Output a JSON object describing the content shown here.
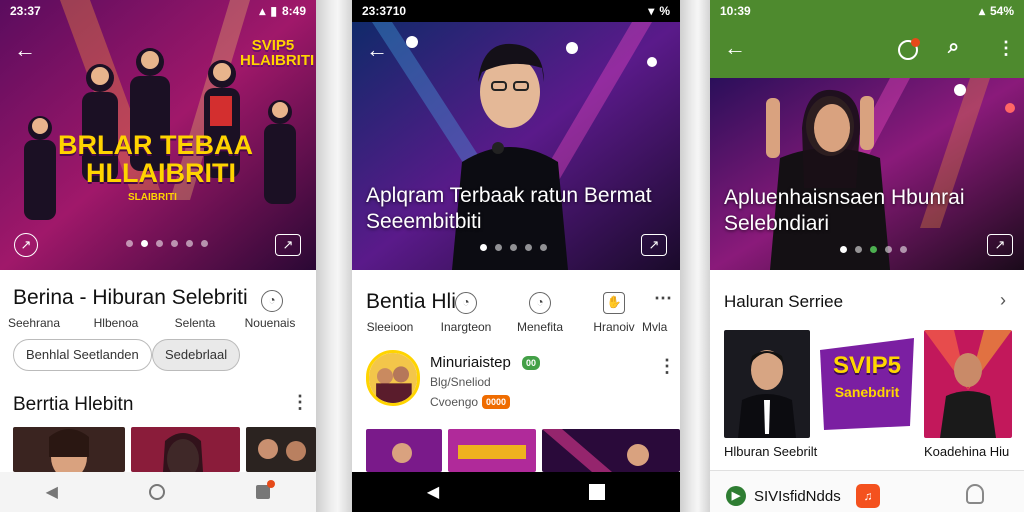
{
  "screen1": {
    "status": {
      "time": "23:37",
      "right": "8:49"
    },
    "hero": {
      "logo": "SVIP5 HLAIBRITI",
      "headline_1": "BRLAR TEBAA",
      "headline_2": "HLLAIBRITI",
      "tagline": "SLAIBRITI"
    },
    "title": "Berina - Hiburan Selebriti",
    "actions": [
      "Seehrana",
      "Hlbenoa",
      "Selenta",
      "Nouenais"
    ],
    "chips": [
      "Benhlal Seetlanden",
      "Sedebrlaal"
    ],
    "section_title": "Berrtia Hlebitn",
    "colors": {
      "accent": "#c2185b",
      "nav_bg": "#f4f4f4"
    }
  },
  "screen2": {
    "status": {
      "time": "23:3710",
      "right": "%"
    },
    "hero": {
      "title": "Aplqram Terbaak ratun Bermat Seeembitbiti"
    },
    "title": "Bentia Hli",
    "actions": [
      "Sleeioon",
      "Inargteon",
      "Menefita",
      "Hranoiv",
      "Mvla"
    ],
    "card": {
      "name": "Minuriaistep",
      "badge": "00",
      "subtitle": "Blg/Sneliod",
      "meta": "Cvoengo",
      "meta_badge": "0000"
    },
    "colors": {
      "badge": "#43a047",
      "meta_badge": "#ef6c00",
      "nav_bg": "#000000"
    }
  },
  "screen3": {
    "status": {
      "time": "10:39",
      "right": "54%"
    },
    "hero": {
      "title": "Apluenhaisnsaen Hbunrai Selebndiari"
    },
    "section_title": "Haluran Serriee",
    "promo_logo": "SVIP5",
    "promo_sub": "Sanebdrit",
    "captions": [
      "Hlburan Seebrilt",
      "Koadehina Hiu"
    ],
    "bottom_label": "SIVIsfidNdds",
    "colors": {
      "appbar": "#4e8a2e",
      "promo_purple": "#7b1fa2",
      "promo_yellow": "#ffd600"
    }
  }
}
